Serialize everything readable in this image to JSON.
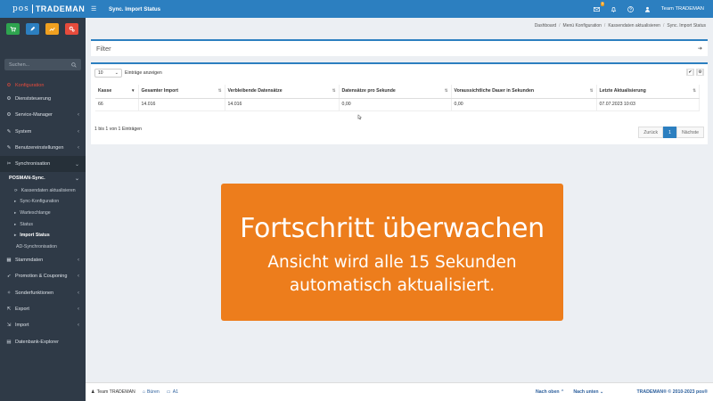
{
  "brand": {
    "pos": "pos",
    "name": "TRADEMAN"
  },
  "quick_buttons": [
    {
      "name": "cart-icon",
      "color": "#2ea44f"
    },
    {
      "name": "pencil-icon",
      "color": "#2c7fc0"
    },
    {
      "name": "chart-icon",
      "color": "#f0a020"
    },
    {
      "name": "cogs-icon",
      "color": "#e64b3c"
    }
  ],
  "search": {
    "placeholder": "Suchen..."
  },
  "sidebar": {
    "section": "Konfiguration",
    "items": [
      {
        "label": "Dienststeuerung",
        "chev": ""
      },
      {
        "label": "Service-Manager",
        "chev": "‹"
      },
      {
        "label": "System",
        "chev": "‹"
      },
      {
        "label": "Benutzereinstellungen",
        "chev": "‹"
      },
      {
        "label": "Synchronisation",
        "chev": "⌄"
      }
    ],
    "pos_sync": "POSMAN-Sync.",
    "sub_items": [
      "Kassendaten aktualisieren",
      "Sync-Konfiguration",
      "Warteschlange",
      "Status",
      "Import Status"
    ],
    "ad_sync": "AD-Synchronisation",
    "items_after": [
      {
        "label": "Stammdaten",
        "chev": "‹"
      },
      {
        "label": "Promotion & Couponing",
        "chev": "‹"
      },
      {
        "label": "Sonderfunktionen",
        "chev": "‹"
      },
      {
        "label": "Export",
        "chev": "‹"
      },
      {
        "label": "Import",
        "chev": "‹"
      },
      {
        "label": "Datenbank-Explorer",
        "chev": ""
      }
    ]
  },
  "topbar": {
    "title": "Sync. Import Status",
    "badge": "3",
    "user": "Team TRADEMAN"
  },
  "breadcrumb": [
    "Dashboard",
    "Menü Konfiguration",
    "Kassendaten aktualisieren",
    "Sync. Import Status"
  ],
  "filter": {
    "title": "Filter"
  },
  "table": {
    "length_value": "10",
    "length_label": "Einträge anzeigen",
    "columns": [
      "Kasse",
      "Gesamter Import",
      "Verbleibende Datensätze",
      "Datensätze pro Sekunde",
      "Voraussichtliche Dauer in Sekunden",
      "Letzte Aktualisierung"
    ],
    "rows": [
      [
        "66",
        "14.016",
        "14.016",
        "0,00",
        "0,00",
        "07.07.2023 10:03"
      ]
    ],
    "info": "1 bis 1 von 1 Einträgen",
    "pager": {
      "prev": "Zurück",
      "current": "1",
      "next": "Nächste"
    }
  },
  "overlay": {
    "headline": "Fortschritt überwachen",
    "line1": "Ansicht wird alle 15 Sekunden",
    "line2": "automatisch aktualisiert."
  },
  "footer": {
    "user": "Team TRADEMAN",
    "location": "Büren",
    "device": "A1",
    "up": "Nach oben",
    "down": "Nach unten",
    "copyright": "TRADEMAN® © 2010-2023 pos®"
  }
}
